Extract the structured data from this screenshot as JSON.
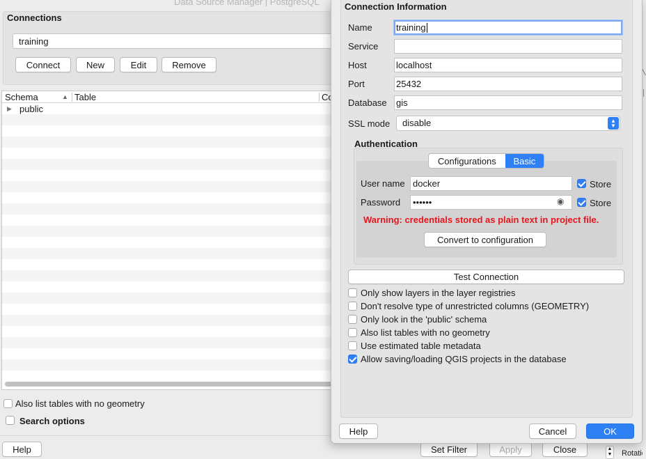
{
  "background_window": {
    "title": "Data Source Manager | PostgreSQL",
    "connections_title": "Connections",
    "selected_connection": "training",
    "buttons": {
      "connect": "Connect",
      "new": "New",
      "edit": "Edit",
      "remove": "Remove"
    },
    "table_columns": [
      "Schema",
      "Table",
      "Co"
    ],
    "tree_items": [
      {
        "label": "public"
      }
    ],
    "also_list_label": "Also list tables with no geometry",
    "search_options_label": "Search options",
    "help_label": "Help",
    "set_filter_label": "Set Filter",
    "apply_label": "Apply",
    "close_label": "Close",
    "rotation_label": "Rotatio"
  },
  "dialog": {
    "section_title": "Connection Information",
    "fields": {
      "name": {
        "label": "Name",
        "value": "training"
      },
      "service": {
        "label": "Service",
        "value": ""
      },
      "host": {
        "label": "Host",
        "value": "localhost"
      },
      "port": {
        "label": "Port",
        "value": "25432"
      },
      "database": {
        "label": "Database",
        "value": "gis"
      }
    },
    "ssl_mode": {
      "label": "SSL mode",
      "value": "disable"
    },
    "authentication": {
      "title": "Authentication",
      "tabs": [
        "Configurations",
        "Basic"
      ],
      "active_tab": "Basic",
      "username": {
        "label": "User name",
        "value": "docker"
      },
      "password": {
        "label": "Password",
        "value": "••••••"
      },
      "store_label": "Store",
      "warning": "Warning: credentials stored as plain text in project file.",
      "convert_label": "Convert to configuration"
    },
    "test_connection_label": "Test Connection",
    "options": [
      {
        "label": "Only show layers in the layer registries",
        "checked": false
      },
      {
        "label": "Don't resolve type of unrestricted columns (GEOMETRY)",
        "checked": false
      },
      {
        "label": "Only look in the 'public' schema",
        "checked": false
      },
      {
        "label": "Also list tables with no geometry",
        "checked": false
      },
      {
        "label": "Use estimated table metadata",
        "checked": false
      },
      {
        "label": "Allow saving/loading QGIS projects in the database",
        "checked": true
      }
    ],
    "help_label": "Help",
    "cancel_label": "Cancel",
    "ok_label": "OK"
  },
  "colors": {
    "accent": "#2f7ff5",
    "warning": "#e8141b",
    "window_bg": "#ececec"
  }
}
